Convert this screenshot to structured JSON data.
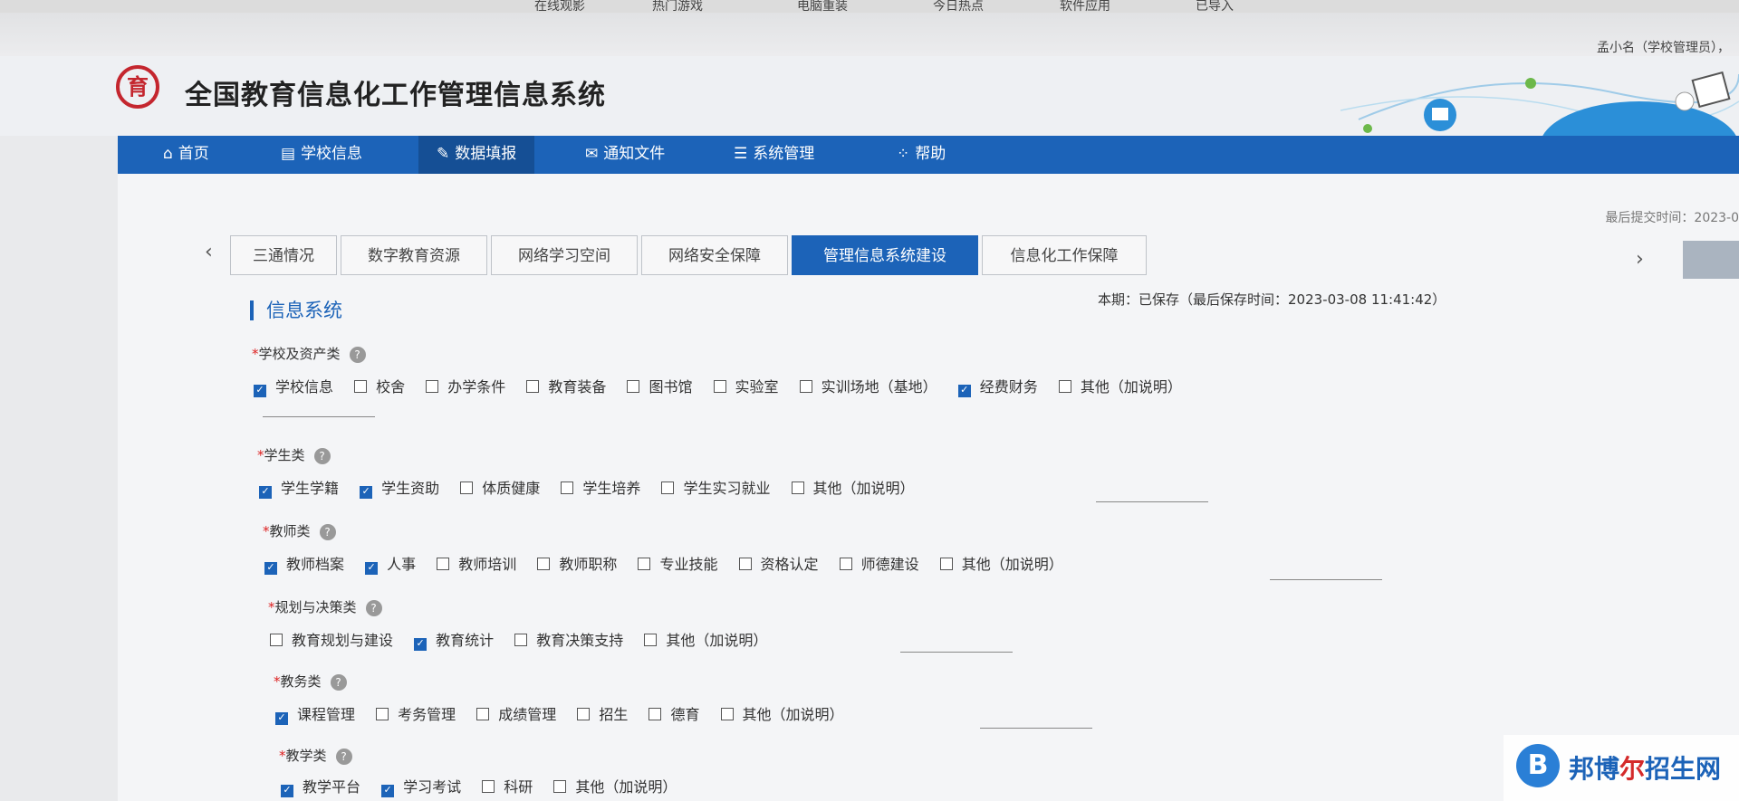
{
  "browser": {
    "bookmarks": [
      "在线观影",
      "热门游戏",
      "电脑重装",
      "今日热点",
      "软件应用",
      "已导入"
    ]
  },
  "user": {
    "label": "孟小名（学校管理员），"
  },
  "site": {
    "title": "全国教育信息化工作管理信息系统",
    "logo_glyph": "育"
  },
  "nav": [
    {
      "label": "首页",
      "icon": "home-icon",
      "glyph": "⌂"
    },
    {
      "label": "学校信息",
      "icon": "document-icon",
      "glyph": "▤"
    },
    {
      "label": "数据填报",
      "icon": "edit-icon",
      "glyph": "✎",
      "active": true
    },
    {
      "label": "通知文件",
      "icon": "mail-icon",
      "glyph": "✉"
    },
    {
      "label": "系统管理",
      "icon": "list-icon",
      "glyph": "☰"
    },
    {
      "label": "帮助",
      "icon": "grid-icon",
      "glyph": "⁘"
    }
  ],
  "last_submit": "最后提交时间：2023-0",
  "tabs": [
    {
      "label": "三通情况"
    },
    {
      "label": "数字教育资源"
    },
    {
      "label": "网络学习空间"
    },
    {
      "label": "网络安全保障"
    },
    {
      "label": "管理信息系统建设",
      "active": true
    },
    {
      "label": "信息化工作保障"
    }
  ],
  "tab_prev_glyph": "‹",
  "tab_next_glyph": "›",
  "save_status": "本期：已保存（最后保存时间：2023-03-08 11:41:42）",
  "section_title": "信息系统",
  "groups": [
    {
      "label": "学校及资产类",
      "options": [
        {
          "label": "学校信息",
          "checked": true
        },
        {
          "label": "校舍",
          "checked": false
        },
        {
          "label": "办学条件",
          "checked": false
        },
        {
          "label": "教育装备",
          "checked": false
        },
        {
          "label": "图书馆",
          "checked": false
        },
        {
          "label": "实验室",
          "checked": false
        },
        {
          "label": "实训场地（基地）",
          "checked": false
        },
        {
          "label": "经费财务",
          "checked": true
        },
        {
          "label": "其他（加说明）",
          "checked": false
        }
      ]
    },
    {
      "label": "学生类",
      "options": [
        {
          "label": "学生学籍",
          "checked": true
        },
        {
          "label": "学生资助",
          "checked": true
        },
        {
          "label": "体质健康",
          "checked": false
        },
        {
          "label": "学生培养",
          "checked": false
        },
        {
          "label": "学生实习就业",
          "checked": false
        },
        {
          "label": "其他（加说明）",
          "checked": false
        }
      ]
    },
    {
      "label": "教师类",
      "options": [
        {
          "label": "教师档案",
          "checked": true
        },
        {
          "label": "人事",
          "checked": true
        },
        {
          "label": "教师培训",
          "checked": false
        },
        {
          "label": "教师职称",
          "checked": false
        },
        {
          "label": "专业技能",
          "checked": false
        },
        {
          "label": "资格认定",
          "checked": false
        },
        {
          "label": "师德建设",
          "checked": false
        },
        {
          "label": "其他（加说明）",
          "checked": false
        }
      ]
    },
    {
      "label": "规划与决策类",
      "options": [
        {
          "label": "教育规划与建设",
          "checked": false
        },
        {
          "label": "教育统计",
          "checked": true
        },
        {
          "label": "教育决策支持",
          "checked": false
        },
        {
          "label": "其他（加说明）",
          "checked": false
        }
      ]
    },
    {
      "label": "教务类",
      "options": [
        {
          "label": "课程管理",
          "checked": true
        },
        {
          "label": "考务管理",
          "checked": false
        },
        {
          "label": "成绩管理",
          "checked": false
        },
        {
          "label": "招生",
          "checked": false
        },
        {
          "label": "德育",
          "checked": false
        },
        {
          "label": "其他（加说明）",
          "checked": false
        }
      ]
    },
    {
      "label": "教学类",
      "options": [
        {
          "label": "教学平台",
          "checked": true
        },
        {
          "label": "学习考试",
          "checked": true
        },
        {
          "label": "科研",
          "checked": false
        },
        {
          "label": "其他（加说明）",
          "checked": false
        }
      ]
    }
  ],
  "watermark": {
    "badge": "B",
    "part1": "邦博",
    "part2": "尔",
    "part3": "招生网"
  },
  "colors": {
    "primary": "#1c63b8",
    "required": "#d22222",
    "logo": "#c4262e"
  }
}
